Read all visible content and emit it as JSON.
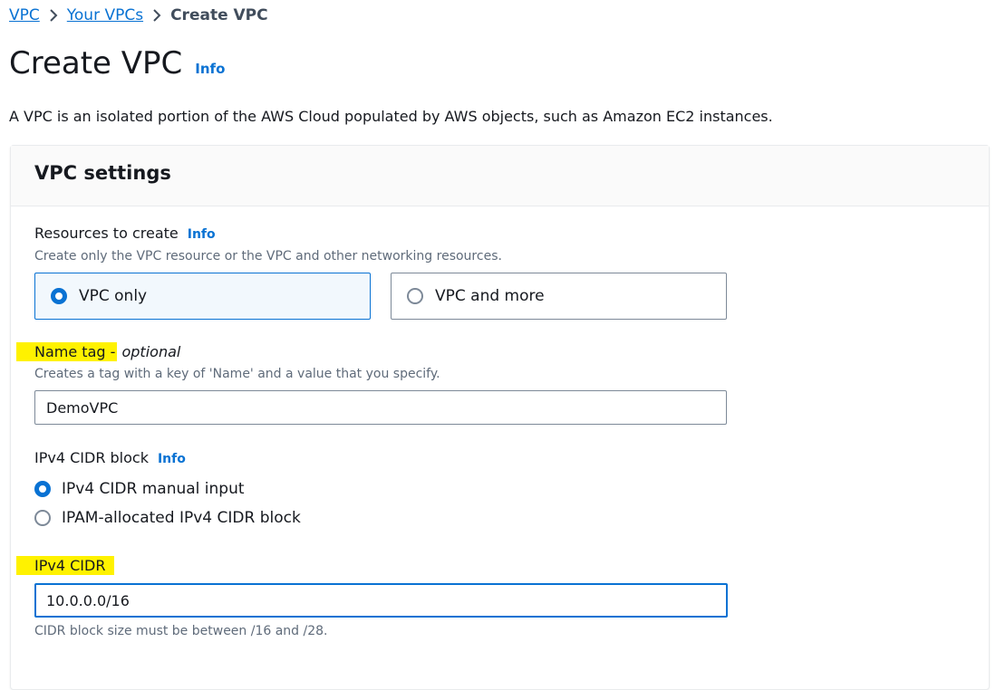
{
  "breadcrumb": {
    "items": [
      "VPC",
      "Your VPCs"
    ],
    "current": "Create VPC"
  },
  "page": {
    "title": "Create VPC",
    "info": "Info",
    "description": "A VPC is an isolated portion of the AWS Cloud populated by AWS objects, such as Amazon EC2 instances."
  },
  "panel": {
    "title": "VPC settings",
    "resources": {
      "label": "Resources to create",
      "info": "Info",
      "hint": "Create only the VPC resource or the VPC and other networking resources.",
      "options": [
        "VPC only",
        "VPC and more"
      ],
      "selected": "VPC only"
    },
    "name_tag": {
      "label": "Name tag -",
      "optional": "optional",
      "hint": "Creates a tag with a key of 'Name' and a value that you specify.",
      "value": "DemoVPC"
    },
    "ipv4_block": {
      "label": "IPv4 CIDR block",
      "info": "Info",
      "options": [
        "IPv4 CIDR manual input",
        "IPAM-allocated IPv4 CIDR block"
      ],
      "selected": "IPv4 CIDR manual input"
    },
    "ipv4_cidr": {
      "label": "IPv4 CIDR",
      "value": "10.0.0.0/16",
      "hint": "CIDR block size must be between /16 and /28."
    }
  },
  "colors": {
    "link": "#0972d3",
    "highlight": "#fff200",
    "selected_tile_bg": "#f2f8fd"
  },
  "icons": {
    "breadcrumb_separator": "chevron-right-icon"
  }
}
